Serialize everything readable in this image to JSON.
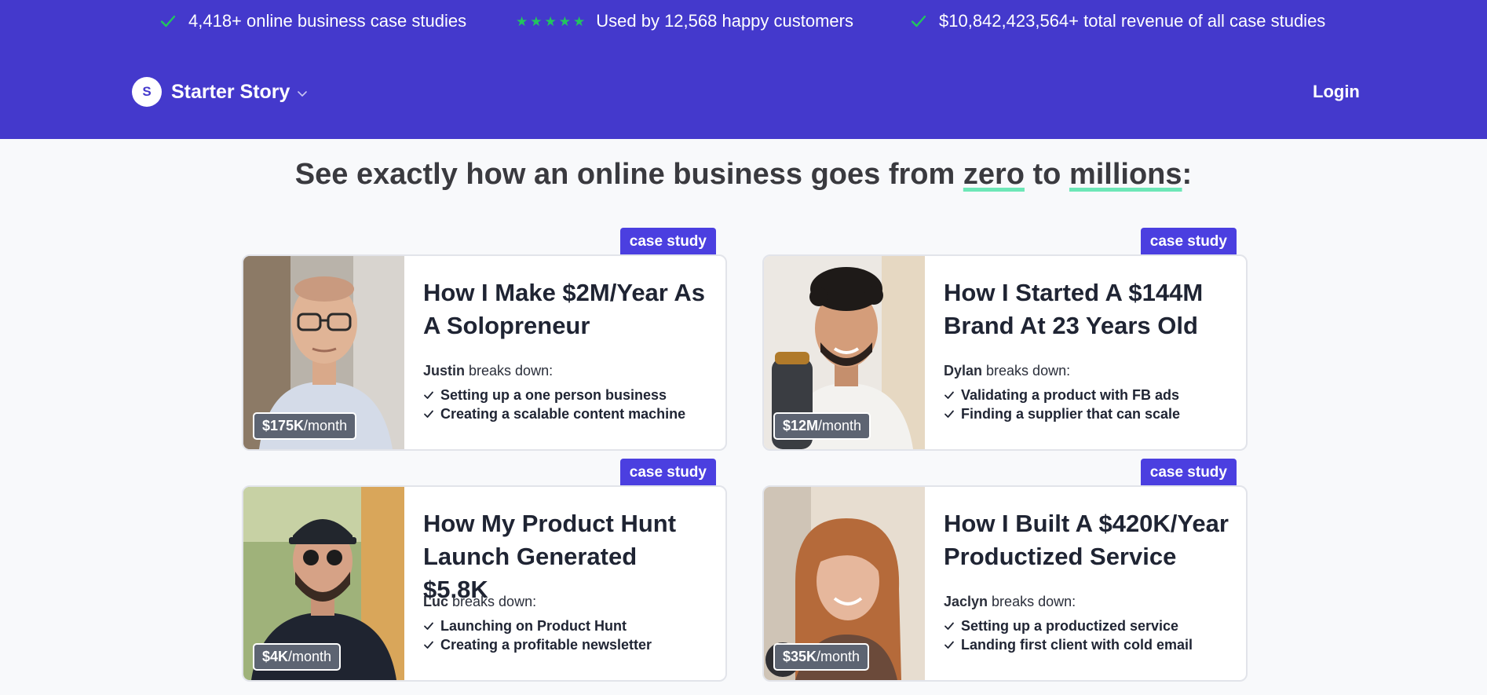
{
  "top_stats": [
    {
      "icon": "check-icon",
      "text": "4,418+ online business case studies"
    },
    {
      "icon": "five-stars-icon",
      "text": "Used by 12,568 happy customers"
    },
    {
      "icon": "check-icon",
      "text": "$10,842,423,564+ total revenue of all case studies"
    }
  ],
  "brand": {
    "badge": "S",
    "name": "Starter Story"
  },
  "nav": {
    "login": "Login"
  },
  "headline": {
    "before": "See exactly how an online business goes from ",
    "word1": "zero",
    "middle": " to ",
    "word2": "millions",
    "after": ":"
  },
  "colors": {
    "header_bg": "#4439cc",
    "tag_bg": "#4b3fe0",
    "star": "#22c55e",
    "highlight": "#6ee7b7"
  },
  "cards": [
    {
      "tag": "case study",
      "title": "How I Make $2M/Year As A Solopreneur",
      "name": "Justin",
      "breaks": " breaks down:",
      "bullets": [
        "Setting up a one person business",
        "Creating a scalable content machine"
      ],
      "revenue": "$175K",
      "per": "/month"
    },
    {
      "tag": "case study",
      "title": "How I Started A $144M Brand At 23 Years Old",
      "name": "Dylan",
      "breaks": " breaks down:",
      "bullets": [
        "Validating a product with FB ads",
        "Finding a supplier that can scale"
      ],
      "revenue": "$12M",
      "per": "/month"
    },
    {
      "tag": "case study",
      "title": "How My Product Hunt Launch Generated $5.8K",
      "name": "Luc",
      "breaks": " breaks down:",
      "bullets": [
        "Launching on Product Hunt",
        "Creating a profitable newsletter"
      ],
      "revenue": "$4K",
      "per": "/month"
    },
    {
      "tag": "case study",
      "title": "How I Built A $420K/Year Productized Service",
      "name": "Jaclyn",
      "breaks": " breaks down:",
      "bullets": [
        "Setting up a productized service",
        "Landing first client with cold email"
      ],
      "revenue": "$35K",
      "per": "/month"
    }
  ]
}
